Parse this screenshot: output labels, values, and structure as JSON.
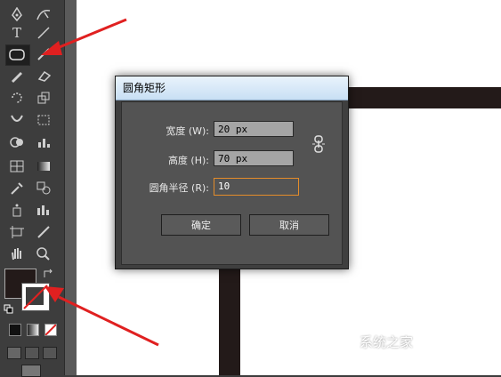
{
  "dialog": {
    "title": "圆角矩形",
    "width_label": "宽度 (W):",
    "width_value": "20 px",
    "height_label": "高度 (H):",
    "height_value": "70 px",
    "radius_label": "圆角半径 (R):",
    "radius_value": "10",
    "ok_label": "确定",
    "cancel_label": "取消"
  },
  "toolbar": {
    "type_tool": "T"
  },
  "watermark": "系统之家",
  "colors": {
    "toolbar_bg": "#3d3d3d",
    "canvas_bg": "#ffffff",
    "shape_fill": "#231a19",
    "arrow": "#e02020",
    "active_field_border": "#e48c2a"
  },
  "icons": [
    "pen-icon",
    "curvature-icon",
    "type-icon",
    "line-icon",
    "rounded-rect-icon",
    "paintbrush-icon",
    "pencil-icon",
    "eraser-icon",
    "rotate-icon",
    "scale-icon",
    "width-icon",
    "free-transform-icon",
    "shape-builder-icon",
    "chart-icon",
    "mesh-icon",
    "gradient-icon",
    "eyedropper-icon",
    "blend-icon",
    "symbol-sprayer-icon",
    "column-graph-icon",
    "artboard-icon",
    "slice-icon",
    "hand-icon",
    "zoom-icon",
    "swap-colors-icon",
    "default-colors-icon"
  ]
}
